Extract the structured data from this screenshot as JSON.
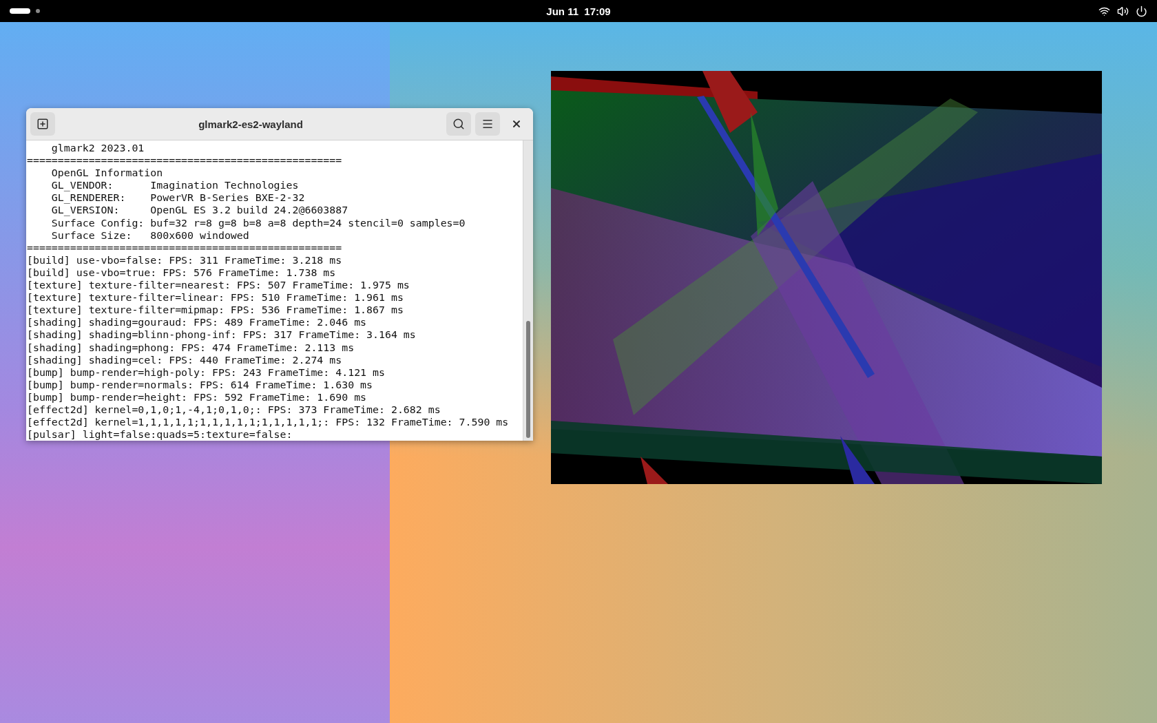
{
  "top_bar": {
    "clock": "Jun 11  17:09"
  },
  "terminal": {
    "title": "glmark2-es2-wayland",
    "lines": [
      "    glmark2 2023.01",
      "===================================================",
      "    OpenGL Information",
      "    GL_VENDOR:      Imagination Technologies",
      "    GL_RENDERER:    PowerVR B-Series BXE-2-32",
      "    GL_VERSION:     OpenGL ES 3.2 build 24.2@6603887",
      "    Surface Config: buf=32 r=8 g=8 b=8 a=8 depth=24 stencil=0 samples=0",
      "    Surface Size:   800x600 windowed",
      "===================================================",
      "[build] use-vbo=false: FPS: 311 FrameTime: 3.218 ms",
      "[build] use-vbo=true: FPS: 576 FrameTime: 1.738 ms",
      "[texture] texture-filter=nearest: FPS: 507 FrameTime: 1.975 ms",
      "[texture] texture-filter=linear: FPS: 510 FrameTime: 1.961 ms",
      "[texture] texture-filter=mipmap: FPS: 536 FrameTime: 1.867 ms",
      "[shading] shading=gouraud: FPS: 489 FrameTime: 2.046 ms",
      "[shading] shading=blinn-phong-inf: FPS: 317 FrameTime: 3.164 ms",
      "[shading] shading=phong: FPS: 474 FrameTime: 2.113 ms",
      "[shading] shading=cel: FPS: 440 FrameTime: 2.274 ms",
      "[bump] bump-render=high-poly: FPS: 243 FrameTime: 4.121 ms",
      "[bump] bump-render=normals: FPS: 614 FrameTime: 1.630 ms",
      "[bump] bump-render=height: FPS: 592 FrameTime: 1.690 ms",
      "[effect2d] kernel=0,1,0;1,-4,1;0,1,0;: FPS: 373 FrameTime: 2.682 ms",
      "[effect2d] kernel=1,1,1,1,1;1,1,1,1,1;1,1,1,1,1;: FPS: 132 FrameTime: 7.590 ms",
      "[pulsar] light=false:quads=5:texture=false:"
    ]
  }
}
